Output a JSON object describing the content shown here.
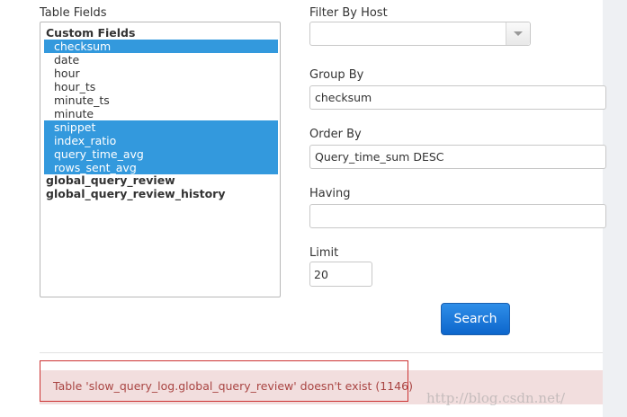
{
  "table_fields": {
    "label": "Table Fields",
    "group_custom_label": "Custom Fields",
    "options": [
      {
        "text": "checksum",
        "selected": true
      },
      {
        "text": "date",
        "selected": false
      },
      {
        "text": "hour",
        "selected": false
      },
      {
        "text": "hour_ts",
        "selected": false
      },
      {
        "text": "minute_ts",
        "selected": false
      },
      {
        "text": "minute",
        "selected": false
      },
      {
        "text": "snippet",
        "selected": true
      },
      {
        "text": "index_ratio",
        "selected": true
      },
      {
        "text": "query_time_avg",
        "selected": true
      },
      {
        "text": "rows_sent_avg",
        "selected": true
      }
    ],
    "group_review_label": "global_query_review",
    "group_review_history_label": "global_query_review_history"
  },
  "filter_by_host": {
    "label": "Filter By Host",
    "value": ""
  },
  "group_by": {
    "label": "Group By",
    "value": "checksum"
  },
  "order_by": {
    "label": "Order By",
    "value": "Query_time_sum DESC"
  },
  "having": {
    "label": "Having",
    "value": ""
  },
  "limit": {
    "label": "Limit",
    "value": "20"
  },
  "search_button": {
    "label": "Search"
  },
  "error": {
    "message": "Table 'slow_query_log.global_query_review' doesn't exist (1146)"
  },
  "watermark": {
    "text": "http://blog.csdn.net/"
  },
  "colors": {
    "selected_bg": "#3399dd",
    "button": "#1a74d8",
    "error_bg": "#f2dede",
    "error_border": "#cc3333"
  }
}
